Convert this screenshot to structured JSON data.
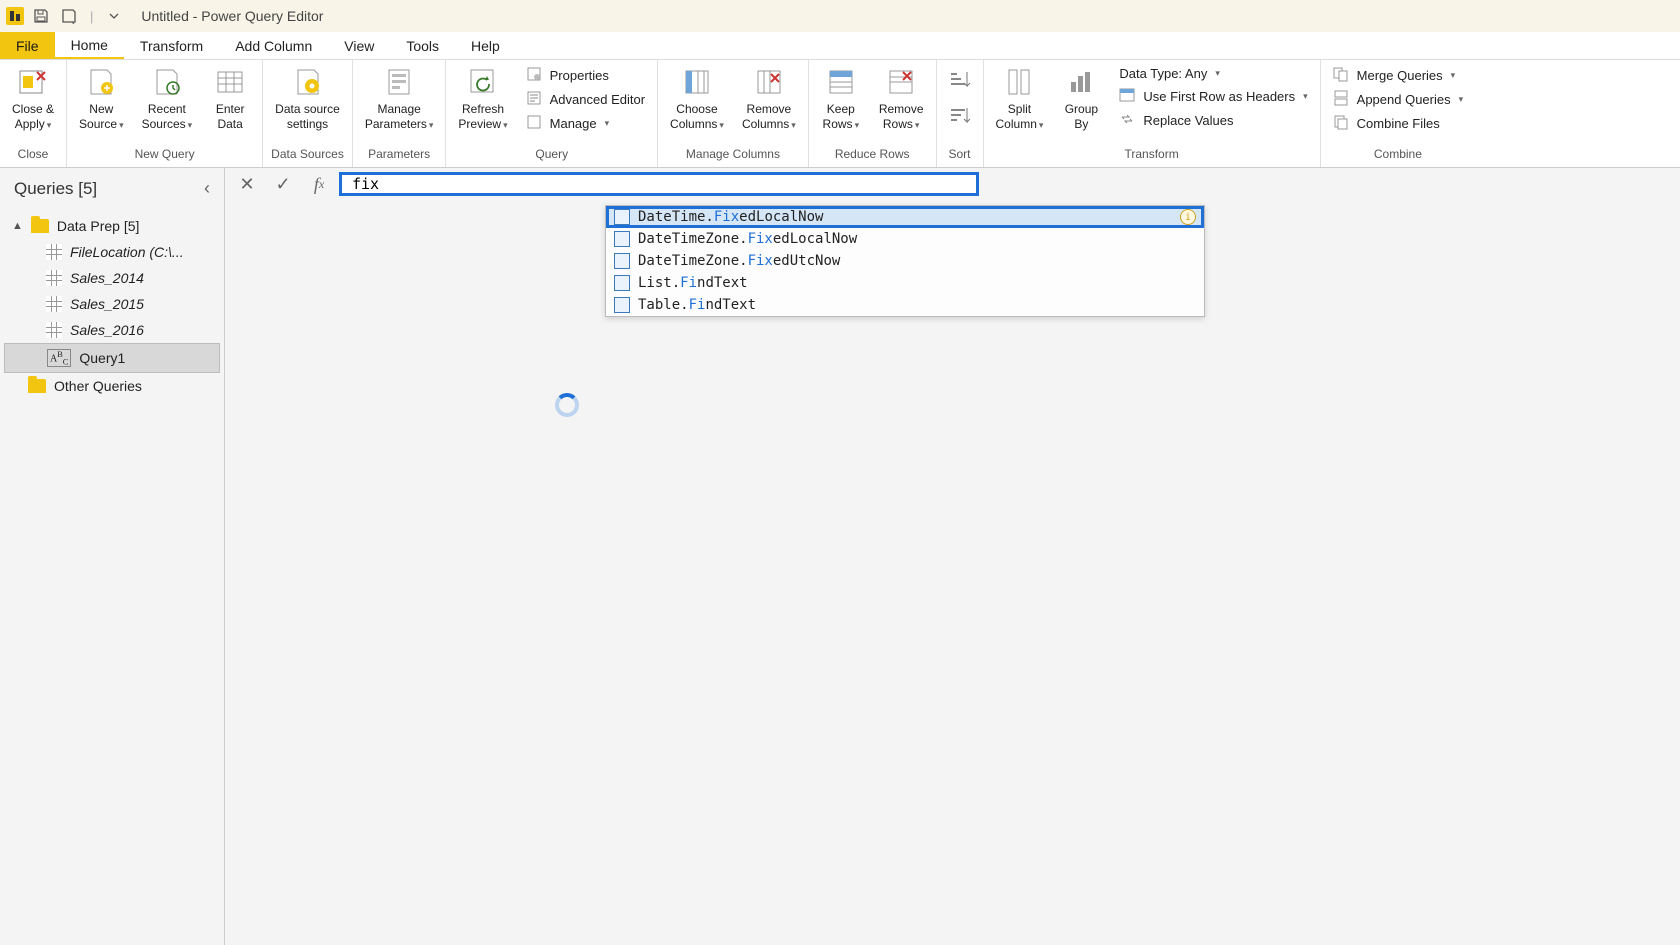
{
  "title": "Untitled - Power Query Editor",
  "tabs": {
    "file": "File",
    "home": "Home",
    "transform": "Transform",
    "add_column": "Add Column",
    "view": "View",
    "tools": "Tools",
    "help": "Help"
  },
  "ribbon": {
    "close": {
      "close_apply": "Close &\nApply",
      "group": "Close"
    },
    "new_query": {
      "new_source": "New\nSource",
      "recent_sources": "Recent\nSources",
      "enter_data": "Enter\nData",
      "group": "New Query"
    },
    "data_sources": {
      "data_source_settings": "Data source\nsettings",
      "group": "Data Sources"
    },
    "parameters": {
      "manage_parameters": "Manage\nParameters",
      "group": "Parameters"
    },
    "query": {
      "refresh_preview": "Refresh\nPreview",
      "properties": "Properties",
      "advanced_editor": "Advanced Editor",
      "manage": "Manage",
      "group": "Query"
    },
    "manage_columns": {
      "choose_columns": "Choose\nColumns",
      "remove_columns": "Remove\nColumns",
      "group": "Manage Columns"
    },
    "reduce_rows": {
      "keep_rows": "Keep\nRows",
      "remove_rows": "Remove\nRows",
      "group": "Reduce Rows"
    },
    "sort": {
      "group": "Sort"
    },
    "transform": {
      "split_column": "Split\nColumn",
      "group_by": "Group\nBy",
      "data_type": "Data Type: Any",
      "first_row_headers": "Use First Row as Headers",
      "replace_values": "Replace Values",
      "group": "Transform"
    },
    "combine": {
      "merge_queries": "Merge Queries",
      "append_queries": "Append Queries",
      "combine_files": "Combine Files",
      "group": "Combine"
    }
  },
  "queries_pane": {
    "header": "Queries [5]",
    "group": "Data Prep [5]",
    "items": [
      {
        "label": "FileLocation (C:\\...",
        "italic": true,
        "type": "table"
      },
      {
        "label": "Sales_2014",
        "italic": true,
        "type": "table"
      },
      {
        "label": "Sales_2015",
        "italic": true,
        "type": "table"
      },
      {
        "label": "Sales_2016",
        "italic": true,
        "type": "table"
      },
      {
        "label": "Query1",
        "italic": false,
        "type": "abc",
        "selected": true
      }
    ],
    "other": "Other Queries"
  },
  "formula": {
    "value": "fix"
  },
  "intellisense": [
    {
      "pre": "DateTime.",
      "hl": "Fix",
      "post": "edLocalNow",
      "selected": true
    },
    {
      "pre": "DateTimeZone.",
      "hl": "Fix",
      "post": "edLocalNow"
    },
    {
      "pre": "DateTimeZone.",
      "hl": "Fix",
      "post": "edUtcNow"
    },
    {
      "pre": "List.",
      "hl": "Fi",
      "post": "ndText"
    },
    {
      "pre": "Table.",
      "hl": "Fi",
      "post": "ndText"
    }
  ]
}
